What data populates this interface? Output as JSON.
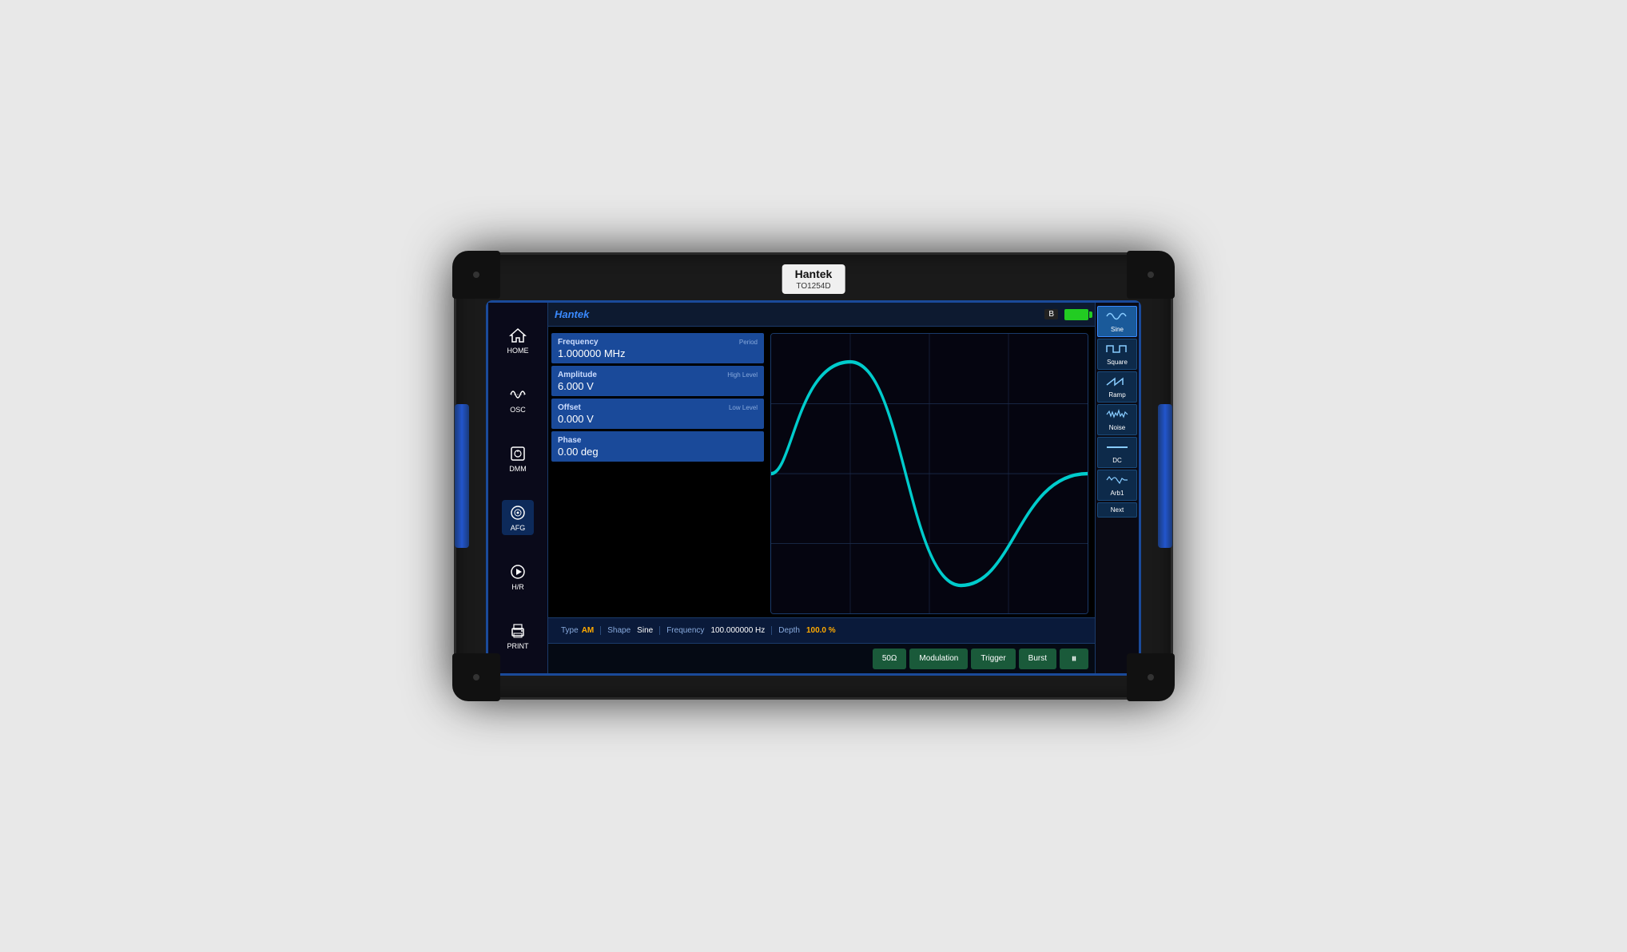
{
  "device": {
    "brand": "Hantek",
    "model": "TO1254D"
  },
  "header": {
    "logo": "Hantek",
    "indicator": "B",
    "battery_color": "#22cc22"
  },
  "nav": {
    "items": [
      {
        "id": "home",
        "label": "HOME",
        "icon": "home"
      },
      {
        "id": "osc",
        "label": "OSC",
        "icon": "osc"
      },
      {
        "id": "dmm",
        "label": "DMM",
        "icon": "dmm"
      },
      {
        "id": "afg",
        "label": "AFG",
        "icon": "afg"
      },
      {
        "id": "hr",
        "label": "H/R",
        "icon": "hr"
      },
      {
        "id": "print",
        "label": "PRINT",
        "icon": "print"
      }
    ]
  },
  "params": [
    {
      "id": "frequency",
      "label": "Frequency",
      "sublabel": "Period",
      "value": "1.000000 MHz"
    },
    {
      "id": "amplitude",
      "label": "Amplitude",
      "sublabel": "High Level",
      "value": "6.000 V"
    },
    {
      "id": "offset",
      "label": "Offset",
      "sublabel": "Low Level",
      "value": "0.000 V"
    },
    {
      "id": "phase",
      "label": "Phase",
      "sublabel": "",
      "value": "0.00 deg"
    }
  ],
  "modulation": {
    "type_label": "Type",
    "type_value": "AM",
    "shape_label": "Shape",
    "shape_value": "Sine",
    "freq_label": "Frequency",
    "freq_value": "100.000000 Hz",
    "depth_label": "Depth",
    "depth_value": "100.0 %"
  },
  "bottom_buttons": [
    {
      "id": "impedance",
      "label": "50Ω"
    },
    {
      "id": "modulation",
      "label": "Modulation"
    },
    {
      "id": "trigger",
      "label": "Trigger"
    },
    {
      "id": "burst",
      "label": "Burst"
    },
    {
      "id": "pause",
      "label": "⏸"
    }
  ],
  "wave_buttons": [
    {
      "id": "sine",
      "label": "Sine",
      "icon": "~",
      "active": true
    },
    {
      "id": "square",
      "label": "Square",
      "icon": "⊓",
      "active": false
    },
    {
      "id": "ramp",
      "label": "Ramp",
      "icon": "∕",
      "active": false
    },
    {
      "id": "noise",
      "label": "Noise",
      "icon": "⌇",
      "active": false
    },
    {
      "id": "dc",
      "label": "DC",
      "icon": "—",
      "active": false
    },
    {
      "id": "arb1",
      "label": "Arb1",
      "icon": "⌇",
      "active": false
    },
    {
      "id": "next",
      "label": "Next",
      "icon": "",
      "active": false
    }
  ],
  "waveform": {
    "color": "#00cccc",
    "background": "#050510"
  }
}
